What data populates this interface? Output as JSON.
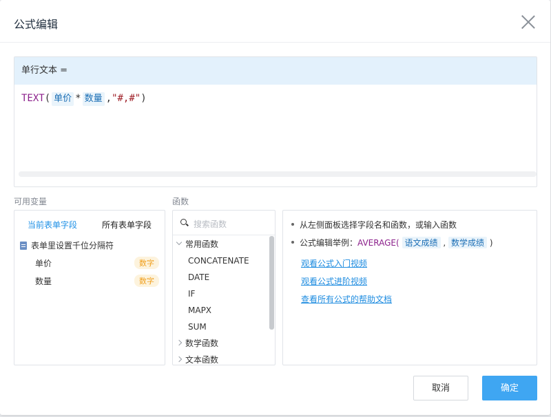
{
  "dialog": {
    "title": "公式编辑"
  },
  "editor": {
    "target_label": "单行文本 =",
    "formula": {
      "fn": "TEXT",
      "open": "(",
      "field1": "单价",
      "op": "*",
      "field2": "数量",
      "comma": ",",
      "str": "\"#,#\"",
      "close": ")"
    }
  },
  "variables": {
    "label": "可用变量",
    "tabs": [
      "当前表单字段",
      "所有表单字段"
    ],
    "group": "表单里设置千位分隔符",
    "items": [
      {
        "name": "单价",
        "type": "数字"
      },
      {
        "name": "数量",
        "type": "数字"
      }
    ]
  },
  "functions": {
    "label": "函数",
    "search_placeholder": "搜索函数",
    "groups": {
      "common": "常用函数",
      "math": "数学函数",
      "text": "文本函数"
    },
    "common_items": [
      "CONCATENATE",
      "DATE",
      "IF",
      "MAPX",
      "SUM"
    ]
  },
  "help": {
    "line1": "从左侧面板选择字段名和函数，或输入函数",
    "example_prefix": "公式编辑举例：",
    "example_fn": "AVERAGE(",
    "example_field1": "语文成绩",
    "example_comma": ",",
    "example_field2": "数学成绩",
    "example_close": ")",
    "links": [
      "观看公式入门视频",
      "观看公式进阶视频",
      "查看所有公式的帮助文档"
    ]
  },
  "buttons": {
    "cancel": "取消",
    "ok": "确定"
  },
  "colors": {
    "accent": "#3fa6f2",
    "link": "#1e8ce0",
    "badge": "#f0a020"
  }
}
